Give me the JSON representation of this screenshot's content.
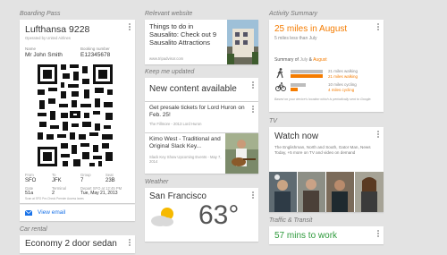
{
  "boarding": {
    "section": "Boarding Pass",
    "flight": "Lufthansa 9228",
    "operated": "Operated by United Airlines",
    "name_label": "Name",
    "name": "Mr John Smith",
    "booking_label": "Booking number",
    "booking": "E12345678",
    "from_label": "From",
    "from": "SFO",
    "to_label": "To",
    "to": "JFK",
    "group_label": "Group",
    "group": "7",
    "seat_label": "Seat",
    "seat": "23B",
    "gate_label": "Gate",
    "gate": "51a",
    "terminal_label": "Terminal",
    "terminal": "2",
    "depart_label": "Depart SFO at",
    "depart_time": "12:45 PM",
    "depart_date": "Tue, May 21, 2013",
    "footnote": "Scan at SFO Pre-Check Premier Access lanes",
    "view_email": "View email",
    "colors": {
      "email_icon": "#1a73e8"
    }
  },
  "car_rental": {
    "section": "Car rental",
    "title": "Economy 2 door sedan"
  },
  "relevant": {
    "section": "Relevant website",
    "title": "Things to do in Sausalito: Check out 9 Sausalito Attractions",
    "url": "www.tripadvisor.com"
  },
  "keep": {
    "section": "Keep me updated",
    "title": "New content available",
    "item1_title": "Get presale tickets for Lord Huron on Feb. 25!",
    "item1_sub": "The Fillmore - 2013 Lord Huron",
    "item2_title": "Kimo West - Traditional and Original Slack Key...",
    "item2_sub": "Slack Key Show Upcoming Events - May 7, 2014"
  },
  "weather": {
    "section": "Weather",
    "city": "San Francisco",
    "temp": "63°",
    "icon": "partly-cloudy"
  },
  "activity": {
    "section": "Activity Summary",
    "title": "25 miles in August",
    "subtitle": "5 miles less than July",
    "summary_label": "Summary of ",
    "july": "July",
    "amp": " & ",
    "august": "August",
    "walk_july": "21 miles walking",
    "walk_aug": "21 miles walking",
    "cyc_july": "10 miles cycling",
    "cyc_aug": "4 miles cycling",
    "walk_july_frac": 0.95,
    "walk_aug_frac": 0.95,
    "cyc_july_frac": 0.45,
    "cyc_aug_frac": 0.2,
    "note": "Based on your device's location which is periodically sent to Google.",
    "colors": {
      "july": "#bdbdbd",
      "august": "#f57c00"
    }
  },
  "tv": {
    "section": "TV",
    "title": "Watch now",
    "desc": "The Englishman, North and South, Gator Man, News Today, +5 more on TV and video on demand"
  },
  "traffic": {
    "section": "Traffic & Transit",
    "title": "57 mins to work"
  }
}
